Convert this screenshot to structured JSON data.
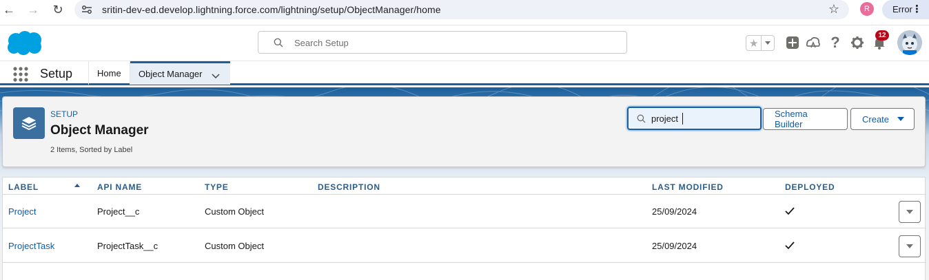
{
  "browser": {
    "url": "sritin-dev-ed.develop.lightning.force.com/lightning/setup/ObjectManager/home",
    "profile_initial": "R",
    "error_label": "Error",
    "menu_glyph": "⋮",
    "back_glyph": "←",
    "forward_glyph": "→",
    "reload_glyph": "↻",
    "bookmark_glyph": "☆"
  },
  "header": {
    "search_placeholder": "Search Setup",
    "favorite_glyph": "★",
    "help_glyph": "?",
    "notification_count": "12"
  },
  "context": {
    "app_name": "Setup",
    "tabs": [
      {
        "label": "Home"
      },
      {
        "label": "Object Manager"
      }
    ]
  },
  "object_manager": {
    "eyebrow": "SETUP",
    "title": "Object Manager",
    "meta": "2 Items, Sorted by Label",
    "quick_find_value": "project",
    "schema_builder_label": "Schema Builder",
    "create_label": "Create"
  },
  "table": {
    "columns": [
      "LABEL",
      "API NAME",
      "TYPE",
      "DESCRIPTION",
      "LAST MODIFIED",
      "DEPLOYED"
    ],
    "rows": [
      {
        "label": "Project",
        "api_name": "Project__c",
        "type": "Custom Object",
        "description": "",
        "last_modified": "25/09/2024",
        "deployed": true
      },
      {
        "label": "ProjectTask",
        "api_name": "ProjectTask__c",
        "type": "Custom Object",
        "description": "",
        "last_modified": "25/09/2024",
        "deployed": true
      }
    ]
  },
  "colors": {
    "brand_blue": "#1b5f9e",
    "link_blue": "#0b5cab",
    "notification_red": "#ba0517",
    "salesforce_cloud": "#00a1e0"
  }
}
